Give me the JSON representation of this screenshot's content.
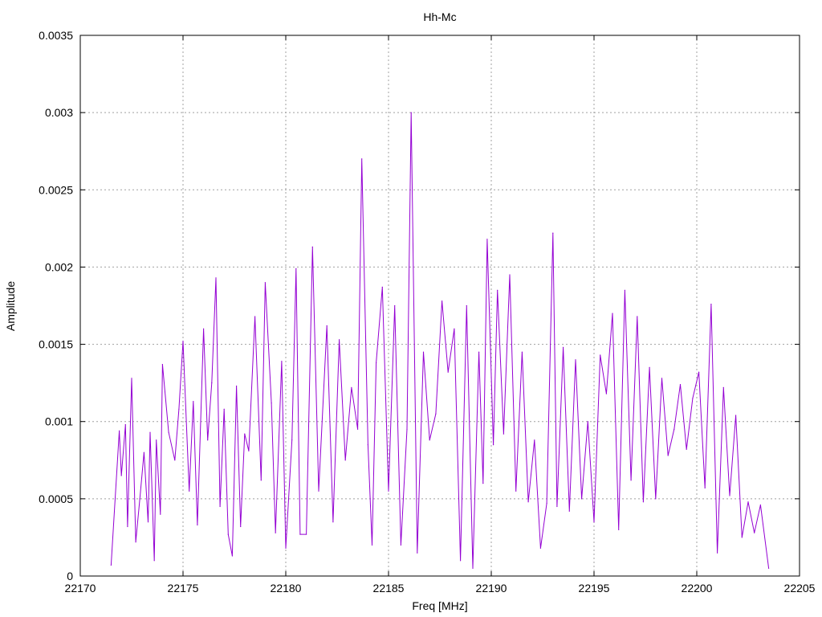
{
  "chart_data": {
    "type": "line",
    "title": "Hh-Mc",
    "xlabel": "Freq [MHz]",
    "ylabel": "Amplitude",
    "xlim": [
      22170,
      22205
    ],
    "ylim": [
      0,
      0.0035
    ],
    "xticks": [
      22170,
      22175,
      22180,
      22185,
      22190,
      22195,
      22200,
      22205
    ],
    "yticks": [
      0,
      0.0005,
      0.001,
      0.0015,
      0.002,
      0.0025,
      0.003,
      0.0035
    ],
    "xtick_labels": [
      "22170",
      "22175",
      "22180",
      "22185",
      "22190",
      "22195",
      "22200",
      "22205"
    ],
    "ytick_labels": [
      "0",
      "0.0005",
      "0.001",
      "0.0015",
      "0.002",
      "0.0025",
      "0.003",
      "0.0035"
    ],
    "grid": true,
    "series": [
      {
        "color": "#9400d3",
        "x": [
          22171.5,
          22171.9,
          22172.0,
          22172.2,
          22172.3,
          22172.5,
          22172.7,
          22172.9,
          22173.1,
          22173.3,
          22173.4,
          22173.6,
          22173.7,
          22173.9,
          22174.0,
          22174.3,
          22174.6,
          22174.8,
          22175.0,
          22175.3,
          22175.5,
          22175.7,
          22176.0,
          22176.2,
          22176.4,
          22176.6,
          22176.8,
          22177.0,
          22177.2,
          22177.4,
          22177.6,
          22177.8,
          22178.0,
          22178.2,
          22178.5,
          22178.8,
          22179.0,
          22179.3,
          22179.5,
          22179.8,
          22180.0,
          22180.3,
          22180.5,
          22180.7,
          22181.0,
          22181.3,
          22181.6,
          22182.0,
          22182.3,
          22182.6,
          22182.9,
          22183.2,
          22183.5,
          22183.7,
          22184.0,
          22184.2,
          22184.4,
          22184.7,
          22185.0,
          22185.3,
          22185.6,
          22185.9,
          22186.1,
          22186.4,
          22186.7,
          22187.0,
          22187.3,
          22187.6,
          22187.9,
          22188.2,
          22188.5,
          22188.8,
          22189.1,
          22189.4,
          22189.6,
          22189.8,
          22190.1,
          22190.3,
          22190.6,
          22190.9,
          22191.2,
          22191.5,
          22191.8,
          22192.1,
          22192.4,
          22192.7,
          22193.0,
          22193.2,
          22193.5,
          22193.8,
          22194.1,
          22194.4,
          22194.7,
          22195.0,
          22195.3,
          22195.6,
          22195.9,
          22196.2,
          22196.5,
          22196.8,
          22197.1,
          22197.4,
          22197.7,
          22198.0,
          22198.3,
          22198.6,
          22198.9,
          22199.2,
          22199.5,
          22199.8,
          22200.1,
          22200.4,
          22200.7,
          22201.0,
          22201.3,
          22201.6,
          22201.9,
          22202.2,
          22202.5,
          22202.8,
          22203.1,
          22203.5
        ],
        "y": [
          7e-05,
          0.00094,
          0.00065,
          0.00098,
          0.00032,
          0.00128,
          0.00022,
          0.0005,
          0.0008,
          0.00035,
          0.00093,
          0.0001,
          0.00088,
          0.0004,
          0.00137,
          0.00093,
          0.00075,
          0.00108,
          0.00152,
          0.00055,
          0.00113,
          0.00033,
          0.0016,
          0.00088,
          0.00125,
          0.00193,
          0.00045,
          0.00108,
          0.00027,
          0.00013,
          0.00123,
          0.00032,
          0.00092,
          0.00081,
          0.00168,
          0.00062,
          0.0019,
          0.00112,
          0.00028,
          0.00139,
          0.00018,
          0.00088,
          0.00199,
          0.00027,
          0.00027,
          0.00213,
          0.00055,
          0.00162,
          0.00035,
          0.00153,
          0.00075,
          0.00122,
          0.00095,
          0.0027,
          0.00085,
          0.0002,
          0.00138,
          0.00187,
          0.00055,
          0.00175,
          0.0002,
          0.00095,
          0.003,
          0.00015,
          0.00145,
          0.00088,
          0.00105,
          0.00178,
          0.00132,
          0.0016,
          0.0001,
          0.00175,
          5e-05,
          0.00145,
          0.0006,
          0.00218,
          0.00085,
          0.00185,
          0.00092,
          0.00195,
          0.00055,
          0.00145,
          0.00048,
          0.00088,
          0.00018,
          0.00047,
          0.00222,
          0.00045,
          0.00148,
          0.00042,
          0.0014,
          0.0005,
          0.001,
          0.00035,
          0.00143,
          0.00118,
          0.0017,
          0.0003,
          0.00185,
          0.00062,
          0.00168,
          0.00048,
          0.00135,
          0.0005,
          0.00128,
          0.00078,
          0.00095,
          0.00124,
          0.00082,
          0.00115,
          0.00132,
          0.00057,
          0.00176,
          0.00015,
          0.00122,
          0.00052,
          0.00104,
          0.00025,
          0.00048,
          0.00028,
          0.00046,
          5e-05
        ]
      }
    ]
  }
}
